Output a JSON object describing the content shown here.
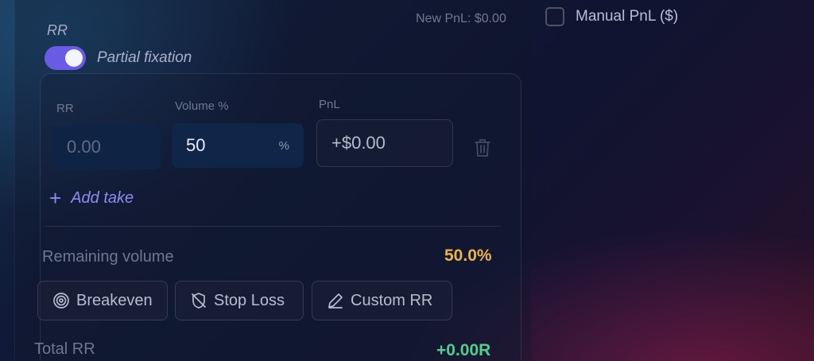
{
  "header": {
    "rr_label": "RR",
    "new_pnl": "New PnL: $0.00",
    "manual_pnl_label": "Manual PnL ($)",
    "manual_pnl_checked": false
  },
  "partial_fixation": {
    "label": "Partial fixation",
    "enabled": true,
    "toggle_color": "#6a5be6"
  },
  "take": {
    "columns": {
      "rr": "RR",
      "volume": "Volume %",
      "pnl": "PnL"
    },
    "rr_placeholder": "0.00",
    "volume_value": "50",
    "volume_unit": "%",
    "pnl_value": "+$0.00",
    "delete_icon": "trash-icon"
  },
  "add_take_label": "Add take",
  "remaining": {
    "label": "Remaining volume",
    "value": "50.0%",
    "color": "#e9b44c"
  },
  "buttons": [
    {
      "label": "Breakeven",
      "icon": "target-icon"
    },
    {
      "label": "Stop Loss",
      "icon": "shield-off-icon"
    },
    {
      "label": "Custom RR",
      "icon": "pencil-icon"
    }
  ],
  "total": {
    "label": "Total RR",
    "value": "+0.00R",
    "color": "#4fcf8e"
  }
}
